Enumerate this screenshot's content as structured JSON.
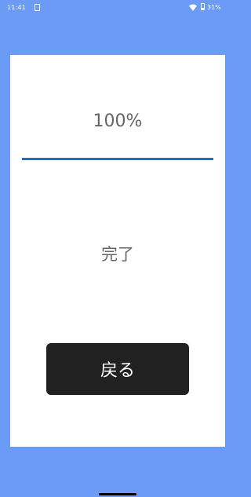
{
  "status_bar": {
    "time": "11:41",
    "sim_icon": "sim-card-icon",
    "wifi_icon": "wifi-icon",
    "battery_icon": "battery-icon",
    "battery_percent": "31%"
  },
  "progress": {
    "label": "100%",
    "value": 1.0,
    "fill_color": "#1f6bd1"
  },
  "status": {
    "text": "完了"
  },
  "back_button": {
    "label": "戻る"
  },
  "colors": {
    "background": "#6b9af7",
    "card": "#ffffff",
    "button": "#212121"
  }
}
